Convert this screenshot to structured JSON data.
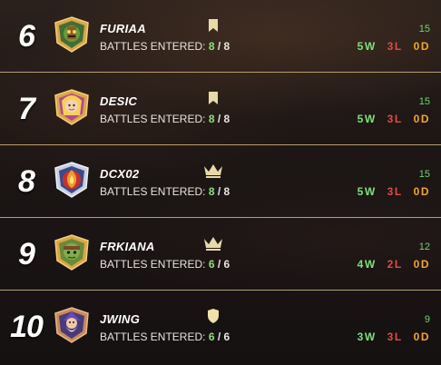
{
  "labels": {
    "battles_entered": "BATTLES ENTERED:"
  },
  "colors": {
    "wins": "#7ee07a",
    "losses": "#e14b45",
    "draws": "#f4a524",
    "divider": "#b99f6b",
    "tier_icon": "#e8d9a8"
  },
  "rows": [
    {
      "rank": "6",
      "name": "FURIAA",
      "entered": "8",
      "total": "8",
      "score": "15",
      "wins": "5W",
      "losses": "3L",
      "draws": "0D",
      "tier_icon": "flag-icon",
      "avatar": "avatar-green-tower"
    },
    {
      "rank": "7",
      "name": "DESIC",
      "entered": "8",
      "total": "8",
      "score": "15",
      "wins": "5W",
      "losses": "3L",
      "draws": "0D",
      "tier_icon": "flag-icon",
      "avatar": "avatar-blonde-mage"
    },
    {
      "rank": "8",
      "name": "DCX02",
      "entered": "8",
      "total": "8",
      "score": "15",
      "wins": "5W",
      "losses": "3L",
      "draws": "0D",
      "tier_icon": "crown-icon",
      "avatar": "avatar-fire-spirit"
    },
    {
      "rank": "9",
      "name": "FRKIANA",
      "entered": "6",
      "total": "6",
      "score": "12",
      "wins": "4W",
      "losses": "2L",
      "draws": "0D",
      "tier_icon": "crown-icon",
      "avatar": "avatar-goblin-knight"
    },
    {
      "rank": "10",
      "name": "JWING",
      "entered": "6",
      "total": "6",
      "score": "9",
      "wins": "3W",
      "losses": "3L",
      "draws": "0D",
      "tier_icon": "shield-icon",
      "avatar": "avatar-bearded-wizard"
    }
  ]
}
